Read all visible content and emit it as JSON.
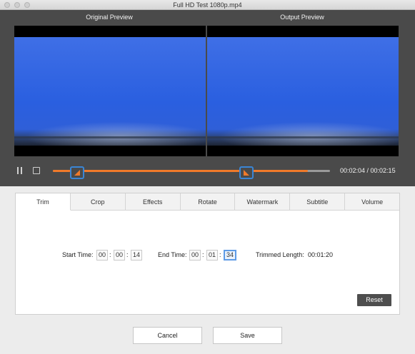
{
  "window": {
    "title": "Full HD Test 1080p.mp4"
  },
  "preview": {
    "original_label": "Original Preview",
    "output_label": "Output  Preview"
  },
  "player": {
    "time_readout": "00:02:04 / 00:02:15",
    "progress_fraction": 0.92,
    "trim_start_fraction": 0.09,
    "trim_end_fraction": 0.7,
    "accent_color": "#f07a2a",
    "handle_color": "#3a86d6"
  },
  "tabs": [
    {
      "label": "Trim",
      "active": true
    },
    {
      "label": "Crop",
      "active": false
    },
    {
      "label": "Effects",
      "active": false
    },
    {
      "label": "Rotate",
      "active": false
    },
    {
      "label": "Watermark",
      "active": false
    },
    {
      "label": "Subtitle",
      "active": false
    },
    {
      "label": "Volume",
      "active": false
    }
  ],
  "trim": {
    "start_label": "Start Time:",
    "start": {
      "h": "00",
      "m": "00",
      "s": "14"
    },
    "end_label": "End Time:",
    "end": {
      "h": "00",
      "m": "01",
      "s": "34"
    },
    "length_label": "Trimmed Length:",
    "length_value": "00:01:20",
    "reset_label": "Reset"
  },
  "footer": {
    "cancel_label": "Cancel",
    "save_label": "Save"
  }
}
